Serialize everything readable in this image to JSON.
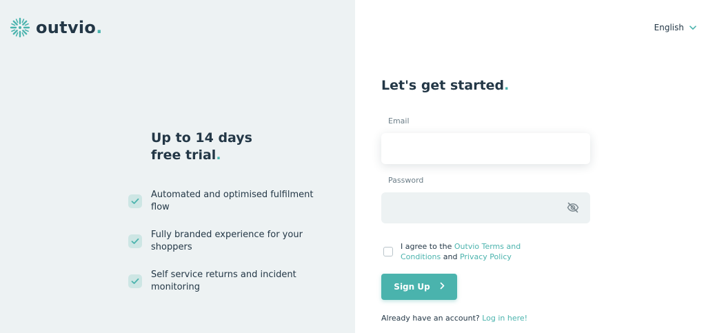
{
  "brand": {
    "name": "outvio",
    "dot": ".",
    "accent_color": "#4ab3ad",
    "text_color": "#233746"
  },
  "promo": {
    "title_line1": "Up to 14 days",
    "title_line2": "free trial",
    "title_dot": ".",
    "features": [
      {
        "icon": "check-icon",
        "text": "Automated and optimised fulfilment flow"
      },
      {
        "icon": "check-icon",
        "text": "Fully branded experience for your shoppers"
      },
      {
        "icon": "check-icon",
        "text": "Self service returns and incident monitoring"
      }
    ]
  },
  "language": {
    "selected": "English",
    "icon": "chevron-down-icon"
  },
  "form": {
    "heading": "Let's get started",
    "heading_dot": ".",
    "email_label": "Email",
    "email_value": "",
    "password_label": "Password",
    "password_value": "",
    "password_toggle_icon": "eye-off-icon",
    "agree": {
      "checked": false,
      "prefix": "I agree to the ",
      "terms_link": "Outvio Terms and Conditions",
      "middle": " and ",
      "privacy_link": "Privacy Policy"
    },
    "submit_label": "Sign Up",
    "submit_icon": "chevron-right-icon",
    "login_prompt": "Already have an account? ",
    "login_link": "Log in here!"
  }
}
